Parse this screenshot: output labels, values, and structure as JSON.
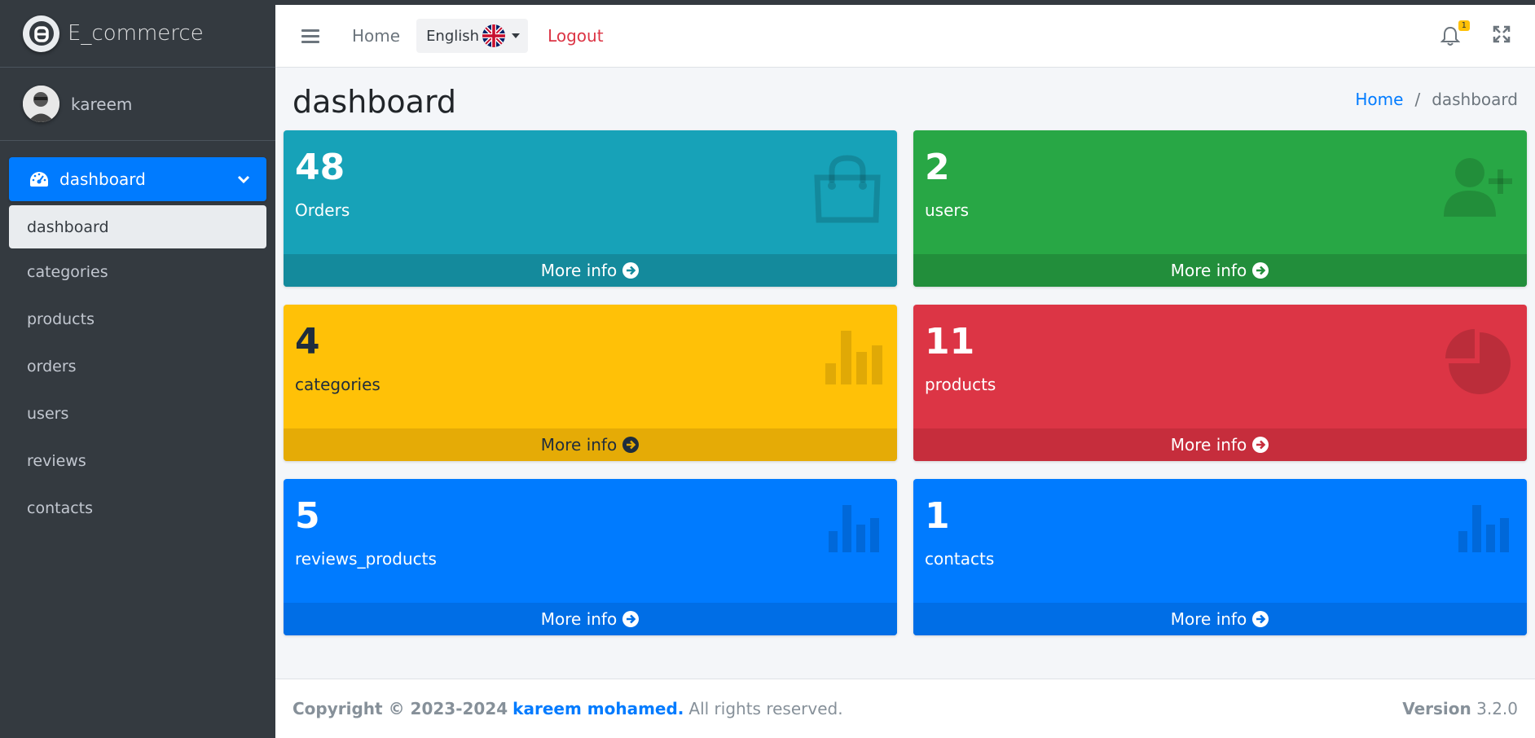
{
  "brand": {
    "name": "E_commerce"
  },
  "user": {
    "name": "kareem"
  },
  "sidebar": {
    "active": {
      "label": "dashboard"
    },
    "sub_active": {
      "label": "dashboard"
    },
    "items": [
      {
        "label": "categories"
      },
      {
        "label": "products"
      },
      {
        "label": "orders"
      },
      {
        "label": "users"
      },
      {
        "label": "reviews"
      },
      {
        "label": "contacts"
      }
    ]
  },
  "header": {
    "home": "Home",
    "language": "English",
    "logout": "Logout",
    "notification_count": "1"
  },
  "page": {
    "title": "dashboard",
    "breadcrumb": {
      "home": "Home",
      "current": "dashboard"
    }
  },
  "boxes": [
    {
      "value": "48",
      "label": "Orders",
      "more": "More info"
    },
    {
      "value": "2",
      "label": "users",
      "more": "More info"
    },
    {
      "value": "4",
      "label": "categories",
      "more": "More info"
    },
    {
      "value": "11",
      "label": "products",
      "more": "More info"
    },
    {
      "value": "5",
      "label": "reviews_products",
      "more": "More info"
    },
    {
      "value": "1",
      "label": "contacts",
      "more": "More info"
    }
  ],
  "footer": {
    "copyright": "Copyright © 2023-2024",
    "author": "kareem mohamed.",
    "rights": "All rights reserved.",
    "version_label": "Version",
    "version_value": "3.2.0"
  },
  "colors": {
    "info": "#17a2b8",
    "success": "#28a745",
    "warning": "#ffc107",
    "danger": "#dc3545",
    "primary": "#007bff",
    "sidebar": "#343a40"
  }
}
